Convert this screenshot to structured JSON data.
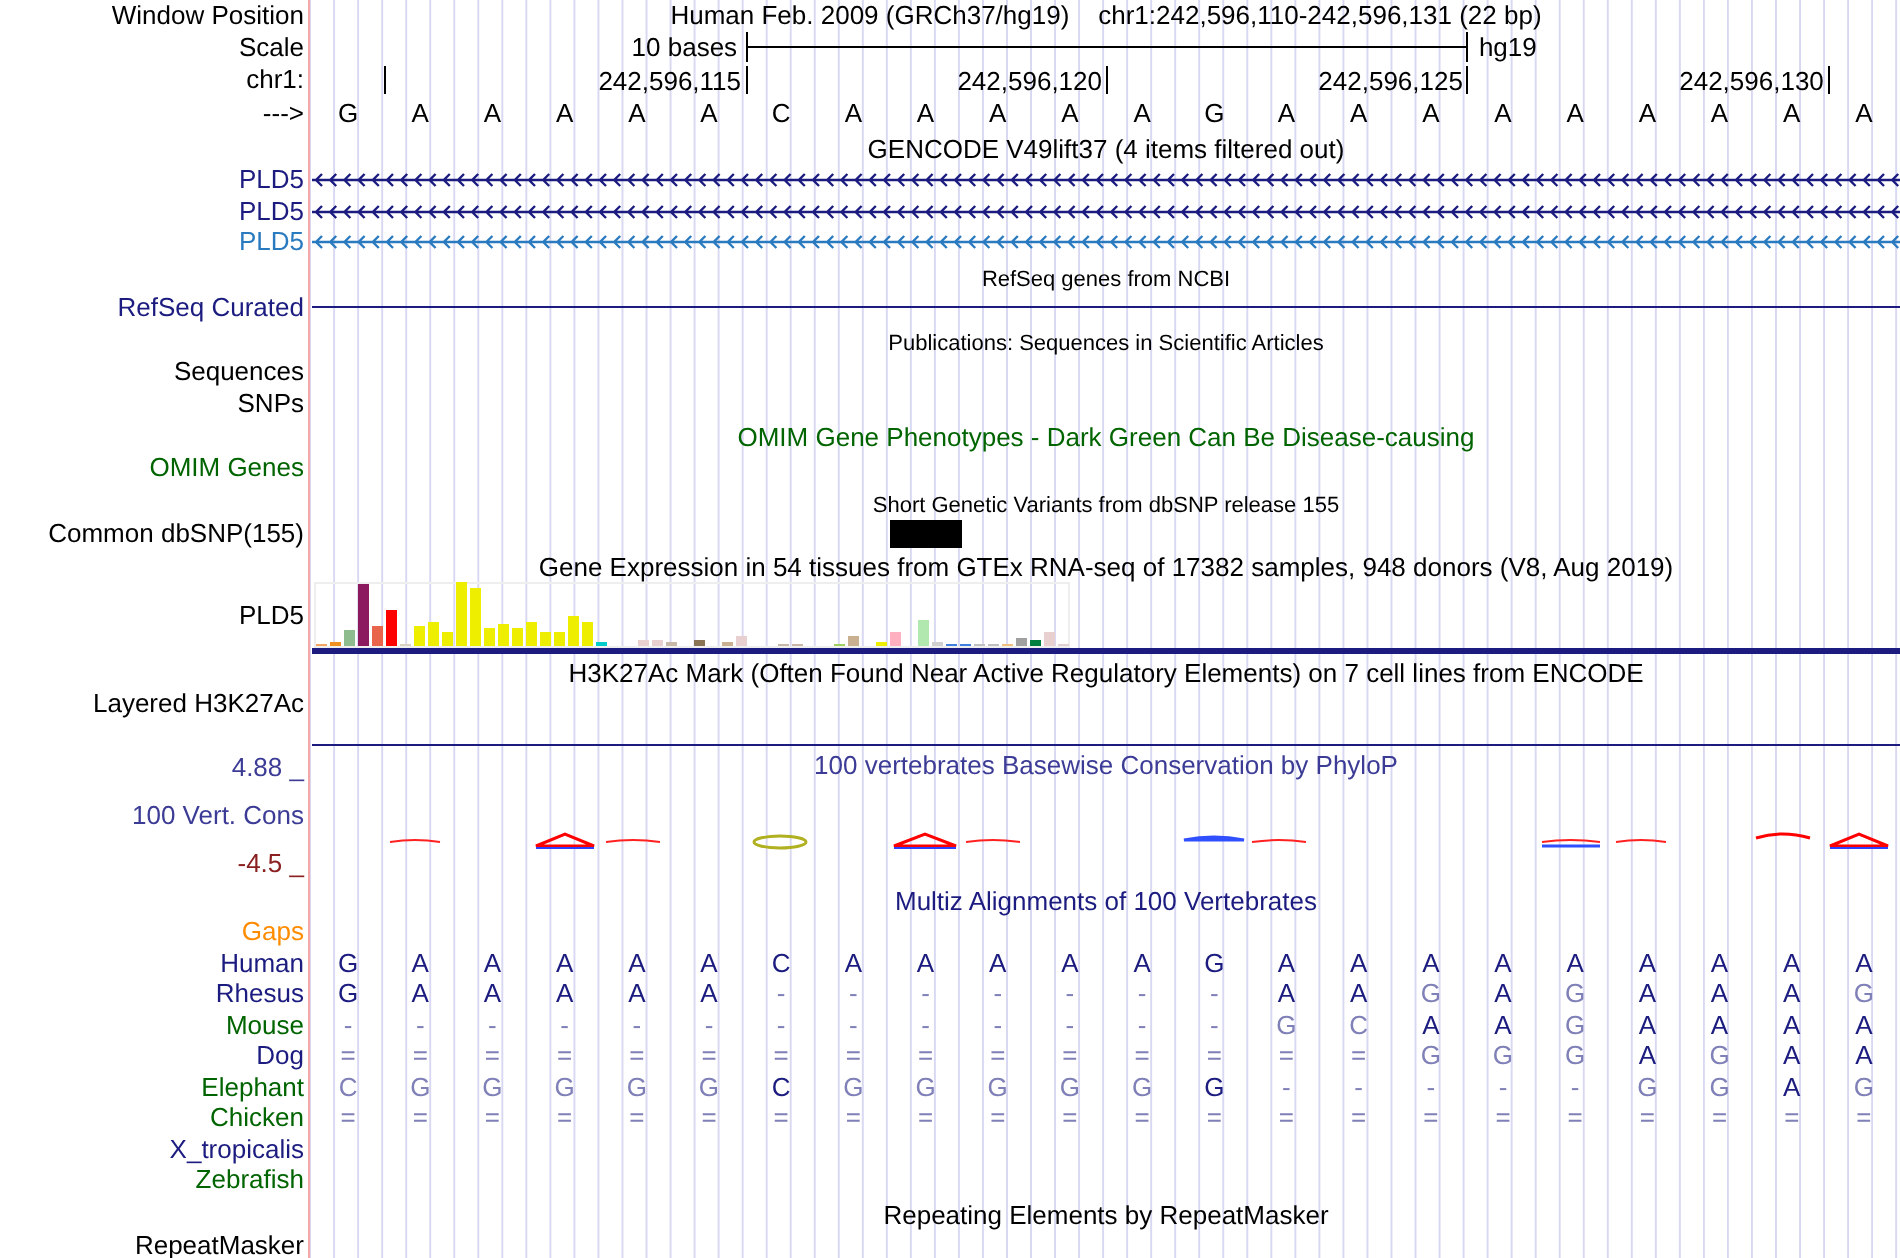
{
  "header": {
    "label": "Window Position",
    "assembly": "Human Feb. 2009 (GRCh37/hg19)",
    "position": "chr1:242,596,110-242,596,131 (22 bp)"
  },
  "scale": {
    "label": "Scale",
    "bar_label": "10 bases",
    "assembly": "hg19"
  },
  "ruler": {
    "label": "chr1:",
    "ticks": [
      "242,596,115",
      "242,596,120",
      "242,596,125",
      "242,596,130"
    ]
  },
  "sequence": {
    "label": "--->",
    "bases": [
      "G",
      "A",
      "A",
      "A",
      "A",
      "A",
      "C",
      "A",
      "A",
      "A",
      "A",
      "A",
      "G",
      "A",
      "A",
      "A",
      "A",
      "A",
      "A",
      "A",
      "A",
      "A"
    ]
  },
  "tracks": [
    {
      "kind": "title",
      "text": "GENCODE V49lift37 (4 items filtered out)"
    },
    {
      "kind": "gene",
      "label": "PLD5",
      "color": "#1c1c80"
    },
    {
      "kind": "gene",
      "label": "PLD5",
      "color": "#1c1c80"
    },
    {
      "kind": "gene",
      "label": "PLD5",
      "color": "#2a7abf"
    },
    {
      "kind": "small_title",
      "text": "RefSeq genes from NCBI"
    },
    {
      "kind": "line",
      "label": "RefSeq Curated",
      "color": "#1c1c80"
    },
    {
      "kind": "small_title",
      "text": "Publications: Sequences in Scientific Articles"
    },
    {
      "kind": "empty",
      "label": "Sequences"
    },
    {
      "kind": "empty",
      "label": "SNPs"
    },
    {
      "kind": "title",
      "color": "#006400",
      "text": "OMIM Gene Phenotypes - Dark Green Can Be Disease-causing"
    },
    {
      "kind": "empty",
      "label": "OMIM Genes",
      "color": "#006400"
    },
    {
      "kind": "small_title",
      "text": "Short Genetic Variants from dbSNP release 155"
    },
    {
      "kind": "variants",
      "label": "Common dbSNP(155)"
    },
    {
      "kind": "title",
      "text": "Gene Expression in 54 tissues from GTEx RNA-seq of 17382 samples, 948 donors (V8, Aug 2019)"
    },
    {
      "kind": "expression",
      "label": "PLD5"
    },
    {
      "kind": "title",
      "text": "H3K27Ac Mark (Often Found Near Active Regulatory Elements) on 7 cell lines from ENCODE"
    },
    {
      "kind": "layered",
      "label": "Layered H3K27Ac"
    },
    {
      "kind": "conservation",
      "title": "100 vertebrates Basewise Conservation by PhyloP",
      "max": "4.88 _",
      "label": "100 Vert. Cons",
      "min": "-4.5 _"
    },
    {
      "kind": "title",
      "color": "#1c1c80",
      "text": "Multiz Alignments of 100 Vertebrates"
    },
    {
      "kind": "empty",
      "label": "Gaps",
      "color": "#ff8c00"
    },
    {
      "kind": "alignment",
      "label": "Human",
      "color": "#1c1c80",
      "bases": [
        {
          "base": "G",
          "faded": false
        },
        {
          "base": "A",
          "faded": false
        },
        {
          "base": "A",
          "faded": false
        },
        {
          "base": "A",
          "faded": false
        },
        {
          "base": "A",
          "faded": false
        },
        {
          "base": "A",
          "faded": false
        },
        {
          "base": "C",
          "faded": false
        },
        {
          "base": "A",
          "faded": false
        },
        {
          "base": "A",
          "faded": false
        },
        {
          "base": "A",
          "faded": false
        },
        {
          "base": "A",
          "faded": false
        },
        {
          "base": "A",
          "faded": false
        },
        {
          "base": "G",
          "faded": false
        },
        {
          "base": "A",
          "faded": false
        },
        {
          "base": "A",
          "faded": false
        },
        {
          "base": "A",
          "faded": false
        },
        {
          "base": "A",
          "faded": false
        },
        {
          "base": "A",
          "faded": false
        },
        {
          "base": "A",
          "faded": false
        },
        {
          "base": "A",
          "faded": false
        },
        {
          "base": "A",
          "faded": false
        },
        {
          "base": "A",
          "faded": false
        }
      ]
    },
    {
      "kind": "alignment",
      "label": "Rhesus",
      "color": "#1c1c80",
      "bases": [
        {
          "base": "G",
          "faded": false
        },
        {
          "base": "A",
          "faded": false
        },
        {
          "base": "A",
          "faded": false
        },
        {
          "base": "A",
          "faded": false
        },
        {
          "base": "A",
          "faded": false
        },
        {
          "base": "A",
          "faded": false
        },
        {
          "base": "-",
          "faded": true
        },
        {
          "base": "-",
          "faded": true
        },
        {
          "base": "-",
          "faded": true
        },
        {
          "base": "-",
          "faded": true
        },
        {
          "base": "-",
          "faded": true
        },
        {
          "base": "-",
          "faded": true
        },
        {
          "base": "-",
          "faded": true
        },
        {
          "base": "A",
          "faded": false
        },
        {
          "base": "A",
          "faded": false
        },
        {
          "base": "G",
          "faded": true
        },
        {
          "base": "A",
          "faded": false
        },
        {
          "base": "G",
          "faded": true
        },
        {
          "base": "A",
          "faded": false
        },
        {
          "base": "A",
          "faded": false
        },
        {
          "base": "A",
          "faded": false
        },
        {
          "base": "G",
          "faded": true
        }
      ]
    },
    {
      "kind": "alignment",
      "label": "Mouse",
      "color": "#006400",
      "bases": [
        {
          "base": "-",
          "faded": true
        },
        {
          "base": "-",
          "faded": true
        },
        {
          "base": "-",
          "faded": true
        },
        {
          "base": "-",
          "faded": true
        },
        {
          "base": "-",
          "faded": true
        },
        {
          "base": "-",
          "faded": true
        },
        {
          "base": "-",
          "faded": true
        },
        {
          "base": "-",
          "faded": true
        },
        {
          "base": "-",
          "faded": true
        },
        {
          "base": "-",
          "faded": true
        },
        {
          "base": "-",
          "faded": true
        },
        {
          "base": "-",
          "faded": true
        },
        {
          "base": "-",
          "faded": true
        },
        {
          "base": "G",
          "faded": true
        },
        {
          "base": "C",
          "faded": true
        },
        {
          "base": "A",
          "faded": false
        },
        {
          "base": "A",
          "faded": false
        },
        {
          "base": "G",
          "faded": true
        },
        {
          "base": "A",
          "faded": false
        },
        {
          "base": "A",
          "faded": false
        },
        {
          "base": "A",
          "faded": false
        },
        {
          "base": "A",
          "faded": false
        }
      ]
    },
    {
      "kind": "alignment",
      "label": "Dog",
      "color": "#1c1c80",
      "bases": [
        {
          "base": "=",
          "faded": true
        },
        {
          "base": "=",
          "faded": true
        },
        {
          "base": "=",
          "faded": true
        },
        {
          "base": "=",
          "faded": true
        },
        {
          "base": "=",
          "faded": true
        },
        {
          "base": "=",
          "faded": true
        },
        {
          "base": "=",
          "faded": true
        },
        {
          "base": "=",
          "faded": true
        },
        {
          "base": "=",
          "faded": true
        },
        {
          "base": "=",
          "faded": true
        },
        {
          "base": "=",
          "faded": true
        },
        {
          "base": "=",
          "faded": true
        },
        {
          "base": "=",
          "faded": true
        },
        {
          "base": "=",
          "faded": true
        },
        {
          "base": "=",
          "faded": true
        },
        {
          "base": "G",
          "faded": true
        },
        {
          "base": "G",
          "faded": true
        },
        {
          "base": "G",
          "faded": true
        },
        {
          "base": "A",
          "faded": false
        },
        {
          "base": "G",
          "faded": true
        },
        {
          "base": "A",
          "faded": false
        },
        {
          "base": "A",
          "faded": false
        }
      ]
    },
    {
      "kind": "alignment",
      "label": "Elephant",
      "color": "#006400",
      "bases": [
        {
          "base": "C",
          "faded": true
        },
        {
          "base": "G",
          "faded": true
        },
        {
          "base": "G",
          "faded": true
        },
        {
          "base": "G",
          "faded": true
        },
        {
          "base": "G",
          "faded": true
        },
        {
          "base": "G",
          "faded": true
        },
        {
          "base": "C",
          "faded": false
        },
        {
          "base": "G",
          "faded": true
        },
        {
          "base": "G",
          "faded": true
        },
        {
          "base": "G",
          "faded": true
        },
        {
          "base": "G",
          "faded": true
        },
        {
          "base": "G",
          "faded": true
        },
        {
          "base": "G",
          "faded": false
        },
        {
          "base": "-",
          "faded": true
        },
        {
          "base": "-",
          "faded": true
        },
        {
          "base": "-",
          "faded": true
        },
        {
          "base": "-",
          "faded": true
        },
        {
          "base": "-",
          "faded": true
        },
        {
          "base": "G",
          "faded": true
        },
        {
          "base": "G",
          "faded": true
        },
        {
          "base": "A",
          "faded": false
        },
        {
          "base": "G",
          "faded": true
        }
      ]
    },
    {
      "kind": "alignment",
      "label": "Chicken",
      "color": "#006400",
      "bases": [
        {
          "base": "=",
          "faded": true
        },
        {
          "base": "=",
          "faded": true
        },
        {
          "base": "=",
          "faded": true
        },
        {
          "base": "=",
          "faded": true
        },
        {
          "base": "=",
          "faded": true
        },
        {
          "base": "=",
          "faded": true
        },
        {
          "base": "=",
          "faded": true
        },
        {
          "base": "=",
          "faded": true
        },
        {
          "base": "=",
          "faded": true
        },
        {
          "base": "=",
          "faded": true
        },
        {
          "base": "=",
          "faded": true
        },
        {
          "base": "=",
          "faded": true
        },
        {
          "base": "=",
          "faded": true
        },
        {
          "base": "=",
          "faded": true
        },
        {
          "base": "=",
          "faded": true
        },
        {
          "base": "=",
          "faded": true
        },
        {
          "base": "=",
          "faded": true
        },
        {
          "base": "=",
          "faded": true
        },
        {
          "base": "=",
          "faded": true
        },
        {
          "base": "=",
          "faded": true
        },
        {
          "base": "=",
          "faded": true
        },
        {
          "base": "=",
          "faded": true
        }
      ]
    },
    {
      "kind": "empty",
      "label": "X_tropicalis",
      "color": "#1c1c80"
    },
    {
      "kind": "empty",
      "label": "Zebrafish",
      "color": "#006400"
    },
    {
      "kind": "title",
      "text": "Repeating Elements by RepeatMasker"
    },
    {
      "kind": "empty",
      "label": "RepeatMasker"
    }
  ]
}
